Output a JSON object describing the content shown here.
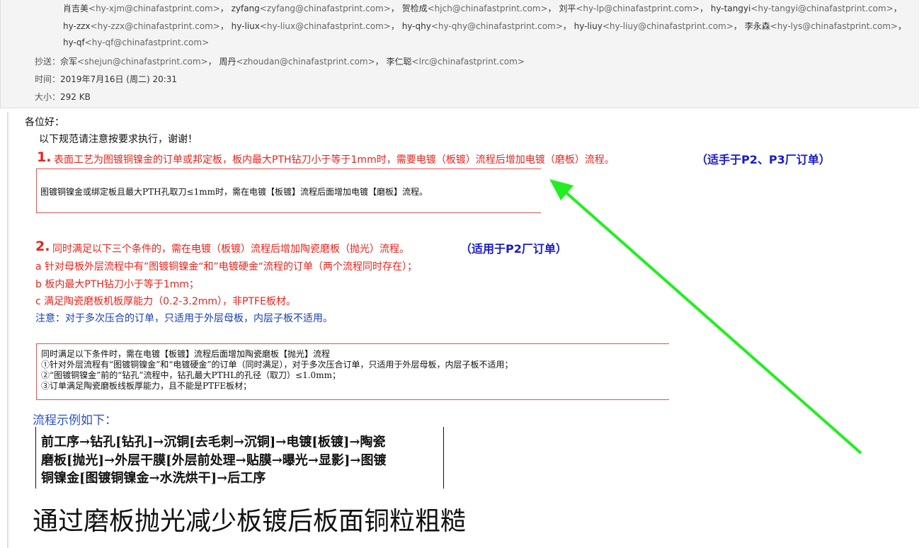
{
  "header": {
    "recipients_line1": [
      {
        "name": "肖吉美",
        "email": "<hy-xjm@chinafastprint.com>"
      },
      {
        "name": "zyfang",
        "email": "<zyfang@chinafastprint.com>"
      },
      {
        "name": "贺检成",
        "email": "<hjch@chinafastprint.com>"
      },
      {
        "name": "刘平",
        "email": "<hy-lp@chinafastprint.com>"
      },
      {
        "name": "hy-tangyi",
        "email": "<hy-tangyi@chinafastprint.com>"
      }
    ],
    "recipients_line2": [
      {
        "name": "hy-zzx",
        "email": "<hy-zzx@chinafastprint.com>"
      },
      {
        "name": "hy-liux",
        "email": "<hy-liux@chinafastprint.com>"
      },
      {
        "name": "hy-qhy",
        "email": "<hy-qhy@chinafastprint.com>"
      },
      {
        "name": "hy-liuy",
        "email": "<hy-liuy@chinafastprint.com>"
      },
      {
        "name": "李永森",
        "email": "<hy-lys@chinafastprint.com>"
      }
    ],
    "recipients_line3": [
      {
        "name": "hy-qf",
        "email": "<hy-qf@chinafastprint.com>"
      }
    ],
    "cc_label": "抄送：",
    "cc": [
      {
        "name": "佘军",
        "email": "<shejun@chinafastprint.com>"
      },
      {
        "name": "周丹",
        "email": "<zhoudan@chinafastprint.com>"
      },
      {
        "name": "李仁聪",
        "email": "<lrc@chinafastprint.com>"
      }
    ],
    "time_label": "时间：",
    "time_value": "2019年7月16日 (周二) 20:31",
    "size_label": "大小：",
    "size_value": "292 KB"
  },
  "body": {
    "greeting": "各位好：",
    "intro": "以下规范请注意按要求执行，谢谢！",
    "item1_num": "1.",
    "item1_text": "表面工艺为图镀铜镍金的订单或邦定板，板内最大PTH钻刀小于等于1mm时，需要电镀（板镀）流程后增加电镀（磨板）流程。",
    "item1_scope": "（适手于P2、P3厂订单）",
    "box1_text": "图镀铜镍金或绑定板且最大PTH孔取刀≤1mm时，需在电镀【板镀】流程后面增加电镀【磨板】流程。",
    "item2_num": "2.",
    "item2_text": "同时满足以下三个条件的，需在电镀（板镀）流程后增加陶瓷磨板（抛光）流程。",
    "item2_scope": "（适用于P2厂订单）",
    "cond_a": "a  针对母板外层流程中有”图镀铜镍金“和”电镀硬金“流程的订单（两个流程同时存在）；",
    "cond_b": "b  板内最大PTH钻刀小于等于1mm；",
    "cond_c": "c  满足陶瓷磨板机板厚能力（0.2-3.2mm），非PTFE板材。",
    "note": "注意：对于多次压合的订单，只适用于外层母板，内层子板不适用。",
    "box2_lines": [
      "同时满足以下条件时，需在电镀【板镀】流程后面增加陶瓷磨板【抛光】流程",
      "①针对外层流程有“图镀铜镍金”和“电镀硬金”的订单（同时满足），对于多次压合订单，只适用于外层母板，内层子板不适用；",
      "②“图镀铜镍金”前的“钻孔”流程中，钻孔最大PTHL的孔径（取刀）≤1.0mm；",
      "③订单满足陶瓷磨板线板厚能力，且不能是PTFE板材；"
    ],
    "flow_heading": "流程示例如下：",
    "flow_lines": [
      "前工序→钻孔[钻孔]→沉铜[去毛刺→沉铜]→电镀[板镀]→陶瓷",
      "磨板[抛光]→外层干膜[外层前处理→贴膜→曝光→显影]→图镀",
      "铜镍金[图镀铜镍金→水洗烘干]→后工序"
    ],
    "big_title": "通过磨板抛光减少板镀后板面铜粒粗糙"
  },
  "colors": {
    "red": "#e8231c",
    "blue": "#1a1acb",
    "arrow": "#22ee22"
  }
}
